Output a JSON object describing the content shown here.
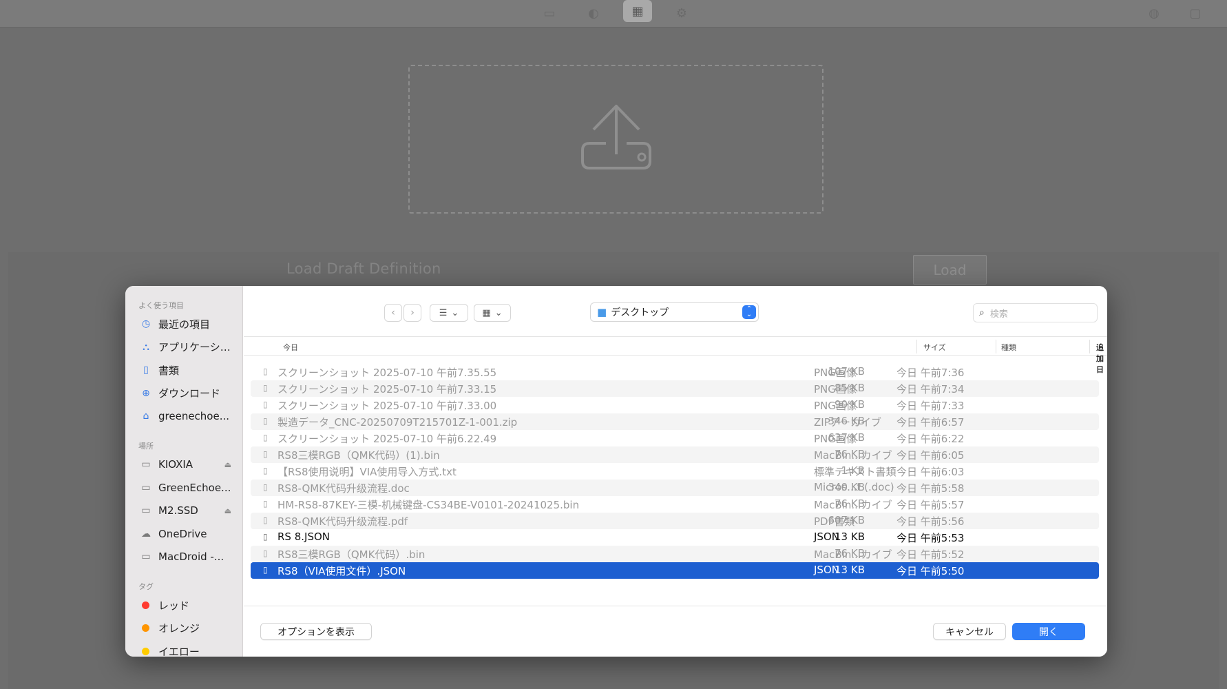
{
  "background": {
    "draft_label": "Load Draft Definition",
    "load_button": "Load"
  },
  "dialog": {
    "sidebar": {
      "favorites_heading": "よく使う項目",
      "favorites": [
        {
          "label": "最近の項目",
          "icon": "clock-icon"
        },
        {
          "label": "アプリケーシ…",
          "icon": "apps-icon"
        },
        {
          "label": "書類",
          "icon": "document-icon"
        },
        {
          "label": "ダウンロード",
          "icon": "download-icon"
        },
        {
          "label": "greenechoe...",
          "icon": "home-icon"
        }
      ],
      "locations_heading": "場所",
      "locations": [
        {
          "label": "KIOXIA",
          "icon": "drive-icon",
          "eject": true
        },
        {
          "label": "GreenEchoe...",
          "icon": "drive-icon",
          "eject": false
        },
        {
          "label": "M2.SSD",
          "icon": "drive-icon",
          "eject": true
        },
        {
          "label": "OneDrive",
          "icon": "cloud-icon",
          "eject": false
        },
        {
          "label": "MacDroid -...",
          "icon": "drive-icon",
          "eject": false
        }
      ],
      "tags_heading": "タグ",
      "tags": [
        {
          "label": "レッド",
          "color": "#ff3b30"
        },
        {
          "label": "オレンジ",
          "color": "#ff9500"
        },
        {
          "label": "イエロー",
          "color": "#ffcc00"
        }
      ]
    },
    "toolbar": {
      "location": "デスクトップ",
      "search_placeholder": "検索"
    },
    "columns": {
      "name": "今日",
      "size": "サイズ",
      "kind": "種類",
      "date": "追加日"
    },
    "files": [
      {
        "name": "スクリーンショット 2025-07-10 午前7.35.55",
        "size": "107 KB",
        "kind": "PNG画像",
        "date": "今日 午前7:36",
        "enabled": false
      },
      {
        "name": "スクリーンショット 2025-07-10 午前7.33.15",
        "size": "85 KB",
        "kind": "PNG画像",
        "date": "今日 午前7:34",
        "enabled": false
      },
      {
        "name": "スクリーンショット 2025-07-10 午前7.33.00",
        "size": "90 KB",
        "kind": "PNG画像",
        "date": "今日 午前7:33",
        "enabled": false
      },
      {
        "name": "製造データ_CNC-20250709T215701Z-1-001.zip",
        "size": "346 KB",
        "kind": "ZIPアーカイブ",
        "date": "今日 午前6:57",
        "enabled": false
      },
      {
        "name": "スクリーンショット 2025-07-10 午前6.22.49",
        "size": "637 KB",
        "kind": "PNG画像",
        "date": "今日 午前6:22",
        "enabled": false
      },
      {
        "name": "RS8三模RGB（QMK代码）(1).bin",
        "size": "76 KB",
        "kind": "MacBin...カイブ",
        "date": "今日 午前6:05",
        "enabled": false
      },
      {
        "name": "【RS8使用说明】VIA使用导入方式.txt",
        "size": "1 KB",
        "kind": "標準テキスト書類",
        "date": "今日 午前6:03",
        "enabled": false
      },
      {
        "name": "RS8-QMK代码升级流程.doc",
        "size": "340 KB",
        "kind": "Micros...t (.doc)",
        "date": "今日 午前5:58",
        "enabled": false
      },
      {
        "name": "HM-RS8-87KEY-三模-机械键盘-CS34BE-V0101-20241025.bin",
        "size": "76 KB",
        "kind": "MacBin...カイブ",
        "date": "今日 午前5:57",
        "enabled": false
      },
      {
        "name": "RS8-QMK代码升级流程.pdf",
        "size": "607 KB",
        "kind": "PDF書類",
        "date": "今日 午前5:56",
        "enabled": false
      },
      {
        "name": "RS 8.JSON",
        "size": "13 KB",
        "kind": "JSON",
        "date": "今日 午前5:53",
        "enabled": true
      },
      {
        "name": "RS8三模RGB（QMK代码）.bin",
        "size": "76 KB",
        "kind": "MacBin...カイブ",
        "date": "今日 午前5:52",
        "enabled": false
      },
      {
        "name": "RS8（VIA使用文件）.JSON",
        "size": "13 KB",
        "kind": "JSON",
        "date": "今日 午前5:50",
        "enabled": true,
        "selected": true
      }
    ],
    "footer": {
      "options_button": "オプションを表示",
      "cancel_button": "キャンセル",
      "open_button": "開く"
    },
    "colors": {
      "accent": "#2f7df6",
      "selection": "#1d5fd1"
    }
  }
}
